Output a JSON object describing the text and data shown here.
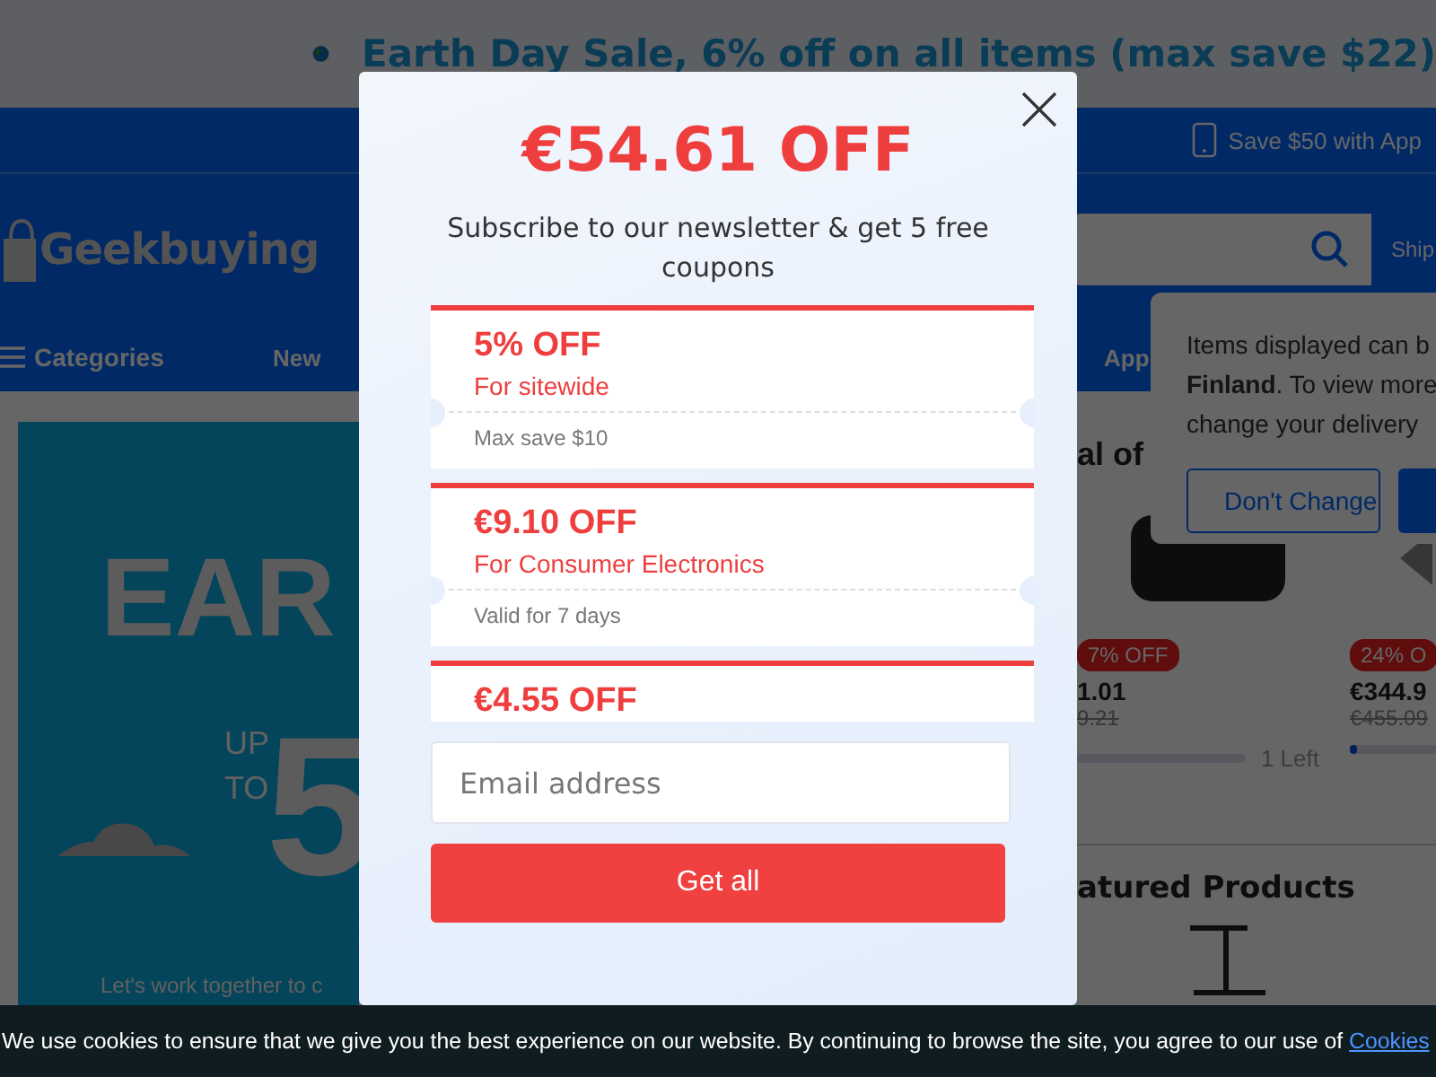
{
  "promo_banner": {
    "text": "Earth Day Sale, 6% off on all items (max save $22)"
  },
  "top_bar": {
    "app_offer": "Save $50 with App"
  },
  "header": {
    "logo": "Geekbuying",
    "ship_label": "Ship"
  },
  "nav": {
    "categories": "Categories",
    "items": [
      "New",
      "App"
    ]
  },
  "hero": {
    "headline": "EAR",
    "up": "UP",
    "to": "TO",
    "number": "5",
    "tagline": "Let's work together to c"
  },
  "deals": {
    "title": "al of",
    "products": [
      {
        "badge": "7% OFF",
        "price": "1.01",
        "old_price": "9.21",
        "stock": "1 Left"
      },
      {
        "badge": "24% O",
        "price": "€344.9",
        "old_price": "€455.09",
        "level": 0.03
      }
    ]
  },
  "featured": {
    "title": "atured Products"
  },
  "delivery_popup": {
    "message": "Items displayed can b\n**Finland**. To view more\nchange your delivery",
    "buttons": [
      {
        "label": "Don't Change",
        "kind": "outline"
      },
      {
        "kind": "filled"
      }
    ]
  },
  "modal": {
    "title": "€54.61 OFF",
    "subtitle": "Subscribe to our newsletter & get 5 free coupons",
    "coupons": [
      {
        "amount": "5% OFF",
        "scope": "For sitewide",
        "note": "Max save $10"
      },
      {
        "amount": "€9.10 OFF",
        "scope": "For Consumer Electronics",
        "note": "Valid for 7 days"
      },
      {
        "amount": "€4.55 OFF"
      }
    ],
    "email_placeholder": "Email address",
    "submit": "Get all"
  },
  "cookie_bar": {
    "text": "We use cookies to ensure that we give you the best experience on our website. By continuing to browse the site, you agree to our use of",
    "link": "Cookies"
  }
}
